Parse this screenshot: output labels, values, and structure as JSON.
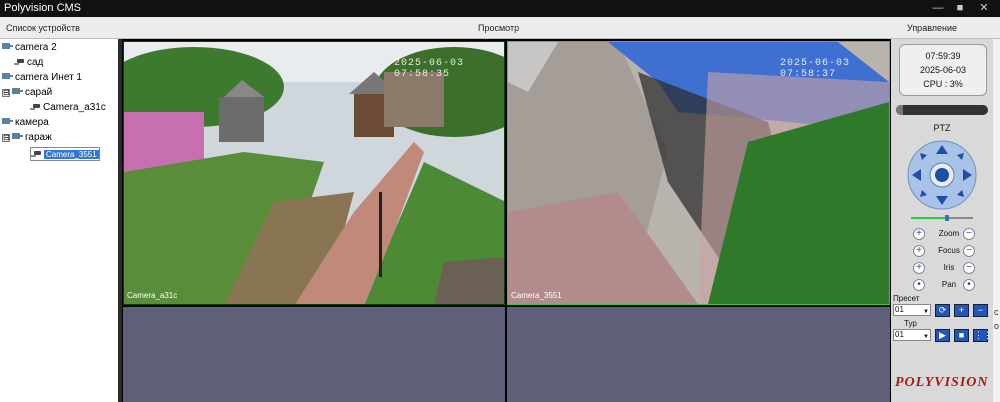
{
  "app": {
    "title": "Polyvision CMS"
  },
  "window_controls": {
    "minimize": "—",
    "maximize": "■",
    "close": "✕"
  },
  "headers": {
    "device_list": "Список устройств",
    "view": "Просмотр",
    "control": "Управление"
  },
  "tree": [
    {
      "label": "camera 2",
      "level": 0,
      "type": "device"
    },
    {
      "label": "сад",
      "level": 1,
      "type": "camera"
    },
    {
      "label": "camera Инет 1",
      "level": 0,
      "type": "device"
    },
    {
      "label": "сарай",
      "level": 1,
      "type": "group",
      "expander": "⊟"
    },
    {
      "label": "Camera_a31c",
      "level": 2,
      "type": "camera"
    },
    {
      "label": "камера",
      "level": 0,
      "type": "device"
    },
    {
      "label": "гараж",
      "level": 1,
      "type": "group",
      "expander": "⊟"
    },
    {
      "label": "Camera_3551",
      "level": 2,
      "type": "camera",
      "selected": true
    }
  ],
  "tiles": [
    {
      "name": "Camera_a31c",
      "timestamp": "2025-06-03 07:58:35"
    },
    {
      "name": "Camera_3551",
      "timestamp": "2025-06-03 07:58:37"
    }
  ],
  "status": {
    "time": "07:59:39",
    "date": "2025-06-03",
    "cpu": "CPU : 3%"
  },
  "ptz": {
    "title": "PTZ",
    "controls": [
      {
        "label": "Zoom",
        "plus": "+",
        "minus": "−"
      },
      {
        "label": "Focus",
        "plus": "+",
        "minus": "−"
      },
      {
        "label": "Iris",
        "plus": "+",
        "minus": "−"
      },
      {
        "label": "Pan",
        "plus": "•",
        "minus": "•"
      }
    ]
  },
  "preset": {
    "label": "Пресет",
    "value": "01"
  },
  "tour": {
    "label": "Тур",
    "value": "01"
  },
  "logo": "POLYVISION",
  "colors": {
    "accent": "#2456b8",
    "selected_tile": "#2ecc40",
    "tree_selection": "#3376d6",
    "empty_tile": "#5f5f7a"
  },
  "right_strip": {
    "c": "с",
    "o": "о"
  }
}
